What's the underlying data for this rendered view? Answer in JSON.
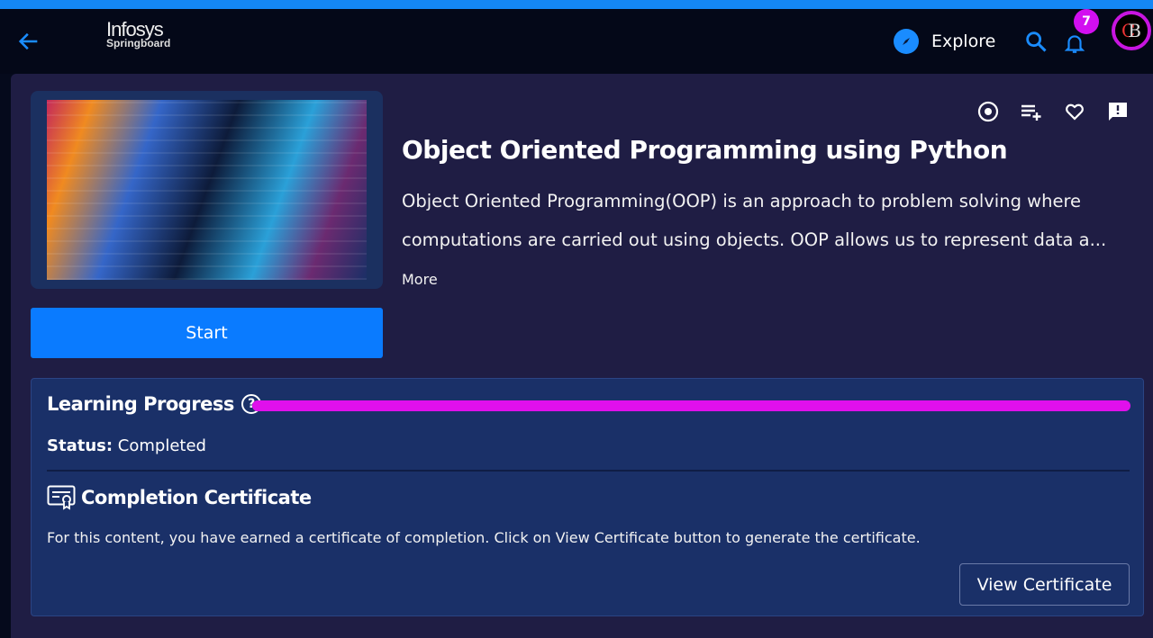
{
  "header": {
    "logo_line1": "Infosys",
    "logo_line2": "Springboard",
    "explore_label": "Explore",
    "notification_count": "7",
    "avatar_initials": "CB"
  },
  "course": {
    "title": "Object Oriented Programming using Python",
    "description": "Object Oriented Programming(OOP) is an approach to problem solving where computations are carried out using objects. OOP allows us to represent data a...",
    "more_label": "More",
    "start_label": "Start"
  },
  "progress": {
    "heading": "Learning Progress",
    "percent": 100,
    "status_label": "Status:",
    "status_value": "Completed",
    "bar_color": "#e010ec"
  },
  "certificate": {
    "heading": "Completion Certificate",
    "text": "For this content, you have earned a certificate of completion. Click on View Certificate button to generate the certificate.",
    "button_label": "View Certificate"
  }
}
